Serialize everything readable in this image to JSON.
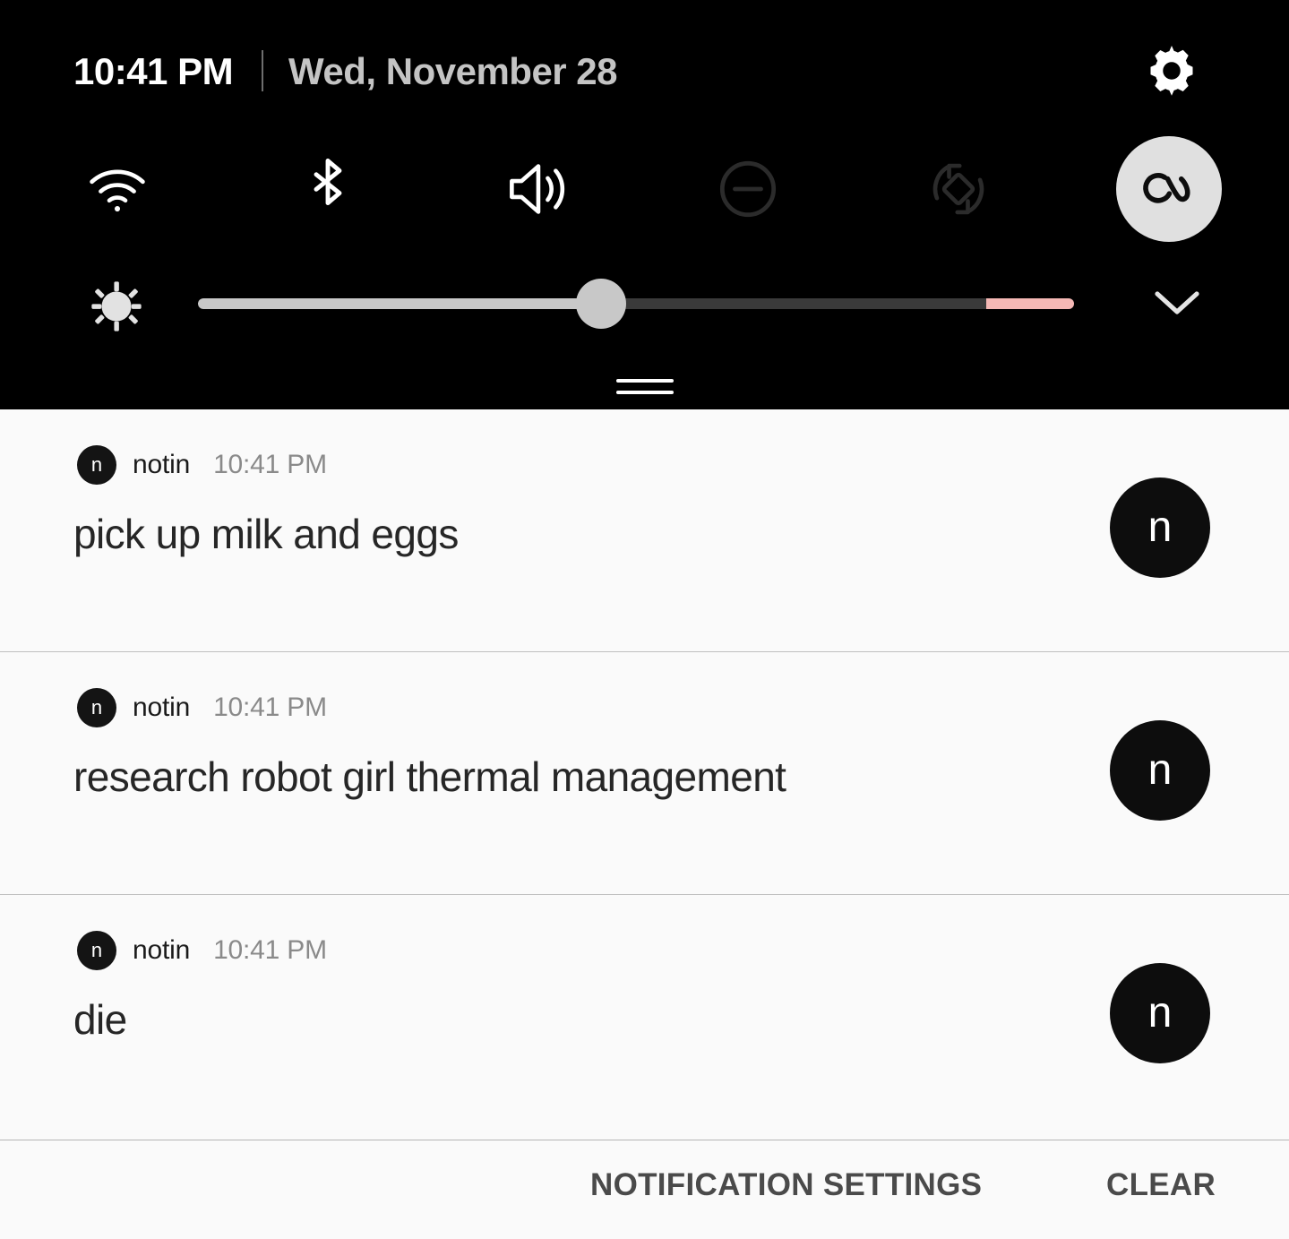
{
  "status_bar": {
    "time": "10:41 PM",
    "date": "Wed, November 28",
    "settings_icon": "gear-icon"
  },
  "quick_settings": {
    "toggles": [
      {
        "name": "wifi",
        "label": "Wi-Fi",
        "icon": "wifi-icon",
        "state": "on",
        "color": "#ffffff"
      },
      {
        "name": "bluetooth",
        "label": "Bluetooth",
        "icon": "bluetooth-icon",
        "state": "on",
        "color": "#ffffff"
      },
      {
        "name": "sound",
        "label": "Sound",
        "icon": "volume-icon",
        "state": "on",
        "color": "#ffffff"
      },
      {
        "name": "dnd",
        "label": "Do not disturb",
        "icon": "do-not-disturb-icon",
        "state": "off",
        "color": "#2b2b2b"
      },
      {
        "name": "auto-rotate",
        "label": "Auto rotate",
        "icon": "auto-rotate-icon",
        "state": "off",
        "color": "#2b2b2b"
      },
      {
        "name": "blue-light",
        "label": "Blue light filter",
        "icon": "eye-comfort-icon",
        "state": "active",
        "color": "#0d0d0d"
      }
    ],
    "brightness": {
      "icon": "brightness-icon",
      "value_percent": 46,
      "warn_start_percent": 90,
      "warn_end_percent": 100,
      "track_color": "#3a3a3a",
      "fill_color": "#c8c8c8",
      "warn_color": "#f5b8b5"
    },
    "expand_icon": "chevron-down-icon",
    "drag_handle": "drag-handle"
  },
  "notifications": [
    {
      "app_icon_letter": "n",
      "app_name": "notin",
      "time": "10:41 PM",
      "text": "pick up milk and eggs",
      "avatar_letter": "n"
    },
    {
      "app_icon_letter": "n",
      "app_name": "notin",
      "time": "10:41 PM",
      "text": "research robot girl thermal management",
      "avatar_letter": "n"
    },
    {
      "app_icon_letter": "n",
      "app_name": "notin",
      "time": "10:41 PM",
      "text": "die",
      "avatar_letter": "n"
    }
  ],
  "action_bar": {
    "notification_settings_label": "NOTIFICATION SETTINGS",
    "clear_label": "CLEAR"
  },
  "colors": {
    "panel_background": "#000000",
    "list_background": "#fafafa",
    "divider": "#bfbfbf",
    "primary_text": "#262626",
    "secondary_text": "#8a8a8a",
    "accent_warn": "#f5b8b5"
  }
}
